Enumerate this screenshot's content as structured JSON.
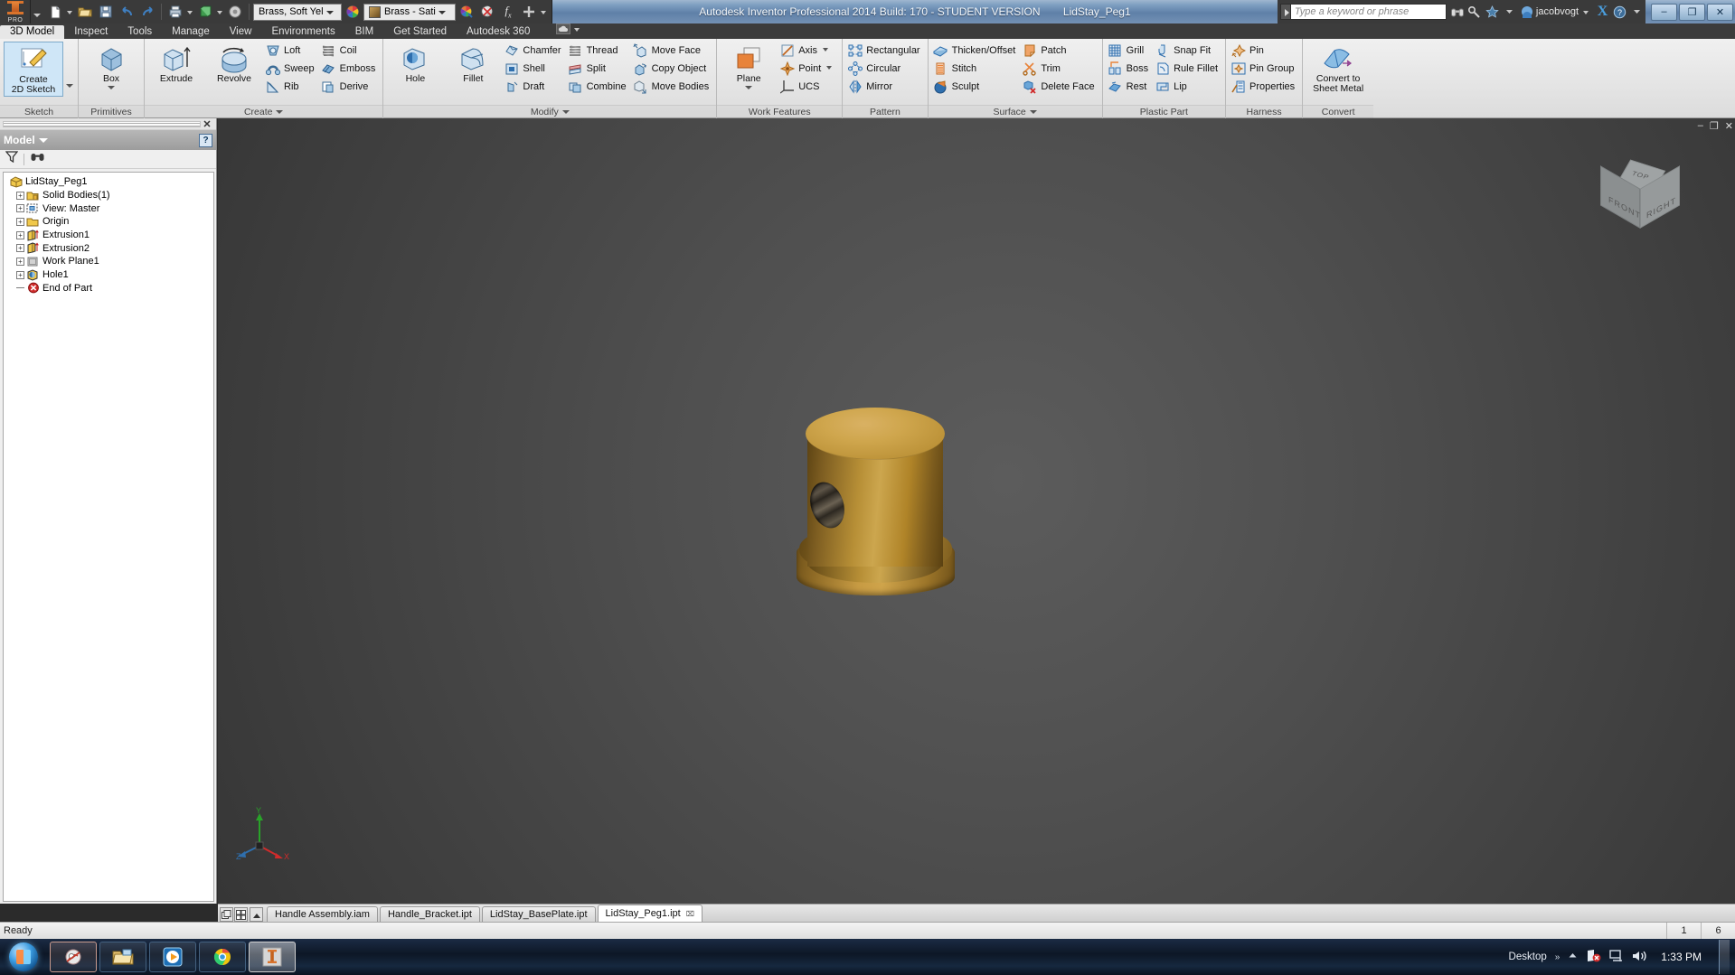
{
  "titlebar": {
    "app_title": "Autodesk Inventor Professional 2014 Build: 170 - STUDENT VERSION",
    "doc_title": "LidStay_Peg1",
    "logo_text": "PRO",
    "material_combo": "Brass, Soft Yel",
    "appearance_combo": "Brass - Sati",
    "search_placeholder": "Type a keyword or phrase",
    "user_name": "jacobvogt",
    "exchange_label": "X",
    "help_label": "?",
    "window_buttons": {
      "minimize": "–",
      "restore": "❐",
      "close": "✕"
    },
    "quick_access": [
      "new-icon",
      "open-icon",
      "save-icon",
      "undo-icon",
      "redo-icon",
      "print-icon",
      "material-icon",
      "appearance-icon"
    ]
  },
  "ribbon_tabs": {
    "items": [
      {
        "label": "3D Model",
        "active": true
      },
      {
        "label": "Inspect",
        "active": false
      },
      {
        "label": "Tools",
        "active": false
      },
      {
        "label": "Manage",
        "active": false
      },
      {
        "label": "View",
        "active": false
      },
      {
        "label": "Environments",
        "active": false
      },
      {
        "label": "BIM",
        "active": false
      },
      {
        "label": "Get Started",
        "active": false
      },
      {
        "label": "Autodesk 360",
        "active": false
      }
    ]
  },
  "ribbon": {
    "panels": [
      {
        "title": "Sketch",
        "big": [
          {
            "label": "Create\n2D Sketch",
            "icon": "sketch-icon",
            "selected": true,
            "dropdown": true
          }
        ],
        "groups": []
      },
      {
        "title": "Primitives",
        "big": [
          {
            "label": "Box",
            "icon": "box-icon",
            "selected": false,
            "dropdown": true
          }
        ],
        "groups": []
      },
      {
        "title": "Create",
        "title_caret": true,
        "big": [
          {
            "label": "Extrude",
            "icon": "extrude-icon",
            "selected": false,
            "dropdown": false
          },
          {
            "label": "Revolve",
            "icon": "revolve-icon",
            "selected": false,
            "dropdown": false
          }
        ],
        "groups": [
          [
            {
              "label": "Loft",
              "icon": "loft-icon"
            },
            {
              "label": "Sweep",
              "icon": "sweep-icon"
            },
            {
              "label": "Rib",
              "icon": "rib-icon"
            }
          ],
          [
            {
              "label": "Coil",
              "icon": "coil-icon"
            },
            {
              "label": "Emboss",
              "icon": "emboss-icon"
            },
            {
              "label": "Derive",
              "icon": "derive-icon"
            }
          ]
        ]
      },
      {
        "title": "Modify",
        "title_caret": true,
        "big": [
          {
            "label": "Hole",
            "icon": "hole-icon",
            "selected": false,
            "dropdown": false
          },
          {
            "label": "Fillet",
            "icon": "fillet-icon",
            "selected": false,
            "dropdown": false
          }
        ],
        "groups": [
          [
            {
              "label": "Chamfer",
              "icon": "chamfer-icon"
            },
            {
              "label": "Shell",
              "icon": "shell-icon"
            },
            {
              "label": "Draft",
              "icon": "draft-icon"
            }
          ],
          [
            {
              "label": "Thread",
              "icon": "thread-icon"
            },
            {
              "label": "Split",
              "icon": "split-icon"
            },
            {
              "label": "Combine",
              "icon": "combine-icon"
            }
          ],
          [
            {
              "label": "Move Face",
              "icon": "move-face-icon"
            },
            {
              "label": "Copy Object",
              "icon": "copy-object-icon"
            },
            {
              "label": "Move Bodies",
              "icon": "move-bodies-icon"
            }
          ]
        ]
      },
      {
        "title": "Work Features",
        "big": [
          {
            "label": "Plane",
            "icon": "plane-icon",
            "selected": false,
            "dropdown": true
          }
        ],
        "groups": [
          [
            {
              "label": "Axis",
              "icon": "axis-icon",
              "caret": true
            },
            {
              "label": "Point",
              "icon": "point-icon",
              "caret": true
            },
            {
              "label": "UCS",
              "icon": "ucs-icon"
            }
          ]
        ]
      },
      {
        "title": "Pattern",
        "big": [],
        "groups": [
          [
            {
              "label": "Rectangular",
              "icon": "rectangular-pattern-icon"
            },
            {
              "label": "Circular",
              "icon": "circular-pattern-icon"
            },
            {
              "label": "Mirror",
              "icon": "mirror-icon"
            }
          ]
        ]
      },
      {
        "title": "Surface",
        "title_caret": true,
        "big": [],
        "groups": [
          [
            {
              "label": "Thicken/Offset",
              "icon": "thicken-offset-icon"
            },
            {
              "label": "Stitch",
              "icon": "stitch-icon"
            },
            {
              "label": "Sculpt",
              "icon": "sculpt-icon"
            }
          ],
          [
            {
              "label": "Patch",
              "icon": "patch-icon"
            },
            {
              "label": "Trim",
              "icon": "trim-icon"
            },
            {
              "label": "Delete Face",
              "icon": "delete-face-icon"
            }
          ]
        ]
      },
      {
        "title": "Plastic Part",
        "big": [],
        "groups": [
          [
            {
              "label": "Grill",
              "icon": "grill-icon"
            },
            {
              "label": "Boss",
              "icon": "boss-icon"
            },
            {
              "label": "Rest",
              "icon": "rest-icon"
            }
          ],
          [
            {
              "label": "Snap Fit",
              "icon": "snap-fit-icon"
            },
            {
              "label": "Rule Fillet",
              "icon": "rule-fillet-icon"
            },
            {
              "label": "Lip",
              "icon": "lip-icon"
            }
          ]
        ]
      },
      {
        "title": "Harness",
        "big": [],
        "groups": [
          [
            {
              "label": "Pin",
              "icon": "pin-icon"
            },
            {
              "label": "Pin Group",
              "icon": "pin-group-icon"
            },
            {
              "label": "Properties",
              "icon": "harness-properties-icon"
            }
          ]
        ]
      },
      {
        "title": "Convert",
        "big": [
          {
            "label": "Convert to\nSheet Metal",
            "icon": "convert-sheet-metal-icon",
            "selected": false,
            "dropdown": false
          }
        ],
        "groups": []
      }
    ]
  },
  "browser": {
    "panel_title": "Model",
    "close_label": "✕",
    "help_label": "?",
    "tools": [
      "filter-icon",
      "find-icon"
    ],
    "tree": [
      {
        "label": "LidStay_Peg1",
        "icon": "part-document-icon",
        "indent": 0,
        "expander": "none"
      },
      {
        "label": "Solid Bodies(1)",
        "icon": "solid-bodies-folder-icon",
        "indent": 1,
        "expander": "plus"
      },
      {
        "label": "View: Master",
        "icon": "view-master-icon",
        "indent": 1,
        "expander": "plus"
      },
      {
        "label": "Origin",
        "icon": "origin-folder-icon",
        "indent": 1,
        "expander": "plus"
      },
      {
        "label": "Extrusion1",
        "icon": "extrusion-icon",
        "indent": 1,
        "expander": "plus"
      },
      {
        "label": "Extrusion2",
        "icon": "extrusion-icon",
        "indent": 1,
        "expander": "plus"
      },
      {
        "label": "Work Plane1",
        "icon": "work-plane-icon",
        "indent": 1,
        "expander": "plus"
      },
      {
        "label": "Hole1",
        "icon": "hole-feature-icon",
        "indent": 1,
        "expander": "plus"
      },
      {
        "label": "End of Part",
        "icon": "end-of-part-icon",
        "indent": 1,
        "expander": "none"
      }
    ]
  },
  "document_window": {
    "minimize": "–",
    "restore": "❐",
    "close": "✕"
  },
  "viewport": {
    "viewcube": {
      "top_label": "TOP",
      "front_label": "FRONT",
      "right_label": "RIGHT"
    },
    "triad": {
      "x_label": "X",
      "y_label": "Y",
      "z_label": "Z"
    },
    "model_name": "LidStay_Peg1",
    "model_color": "#c9a24a",
    "background_color": "#4f4f4f"
  },
  "doc_tabs": {
    "items": [
      {
        "label": "Handle Assembly.iam",
        "active": false,
        "closable": false
      },
      {
        "label": "Handle_Bracket.ipt",
        "active": false,
        "closable": false
      },
      {
        "label": "LidStay_BasePlate.ipt",
        "active": false,
        "closable": false
      },
      {
        "label": "LidStay_Peg1.ipt",
        "active": true,
        "closable": true
      }
    ],
    "close_mark": "⌧"
  },
  "statusbar": {
    "message": "Ready",
    "cells": [
      "1",
      "6"
    ]
  },
  "taskbar": {
    "start_label": "start-orb-icon",
    "items": [
      {
        "name": "media-player-icon",
        "state": "pinned"
      },
      {
        "name": "explorer-folder-icon",
        "state": "normal"
      },
      {
        "name": "media-center-icon",
        "state": "normal"
      },
      {
        "name": "chrome-icon",
        "state": "normal"
      },
      {
        "name": "inventor-icon",
        "state": "active"
      }
    ],
    "tray_label": "Desktop",
    "tray_chevron": "»",
    "tray_icons": [
      "network-error-icon",
      "display-icon",
      "volume-icon"
    ],
    "clock": "1:33 PM"
  }
}
